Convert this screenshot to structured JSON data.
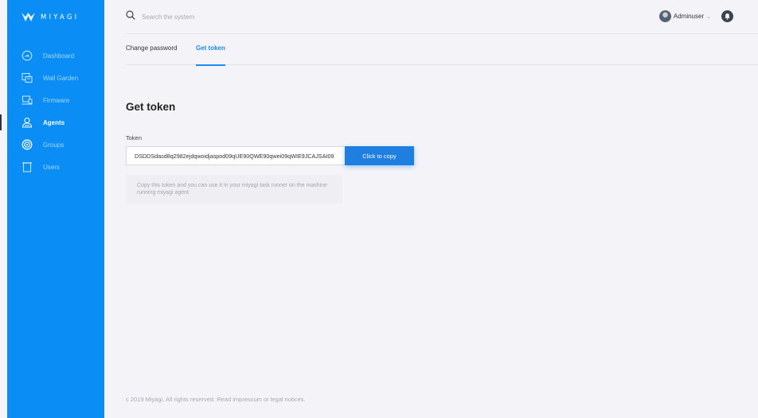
{
  "app": {
    "logo_text": "MIYAGI"
  },
  "sidebar": {
    "items": [
      {
        "label": "Dashboard",
        "icon": "dashboard-icon",
        "active": false
      },
      {
        "label": "Wall Garden",
        "icon": "wall-garden-icon",
        "active": false
      },
      {
        "label": "Firmware",
        "icon": "firmware-icon",
        "active": false
      },
      {
        "label": "Agents",
        "icon": "agents-icon",
        "active": true
      },
      {
        "label": "Groups",
        "icon": "groups-icon",
        "active": false
      },
      {
        "label": "Users",
        "icon": "users-icon",
        "active": false
      }
    ]
  },
  "header": {
    "search_placeholder": "Search the system",
    "username": "Adminuser",
    "caret": "⌄"
  },
  "tabs": [
    {
      "label": "Change password",
      "active": false
    },
    {
      "label": "Get token",
      "active": true
    }
  ],
  "main": {
    "title": "Get token",
    "token_label": "Token",
    "token_value": "DSDDSdasd8q2982ejdqwoidjaspod09qUE90QWE90qwei09qWIE9JCAJSAI09",
    "copy_button": "Click to copy",
    "hint": "Copy this token and you can use it in your miyagi task runner on the mashine running miyagi agent"
  },
  "footer": {
    "text": "c 2019 Miyagi. All rights reserved. Read impressum or legal notices."
  },
  "colors": {
    "sidebar": "#0a8ef5",
    "accent": "#1a8cf0",
    "background": "#f4f4f8"
  }
}
